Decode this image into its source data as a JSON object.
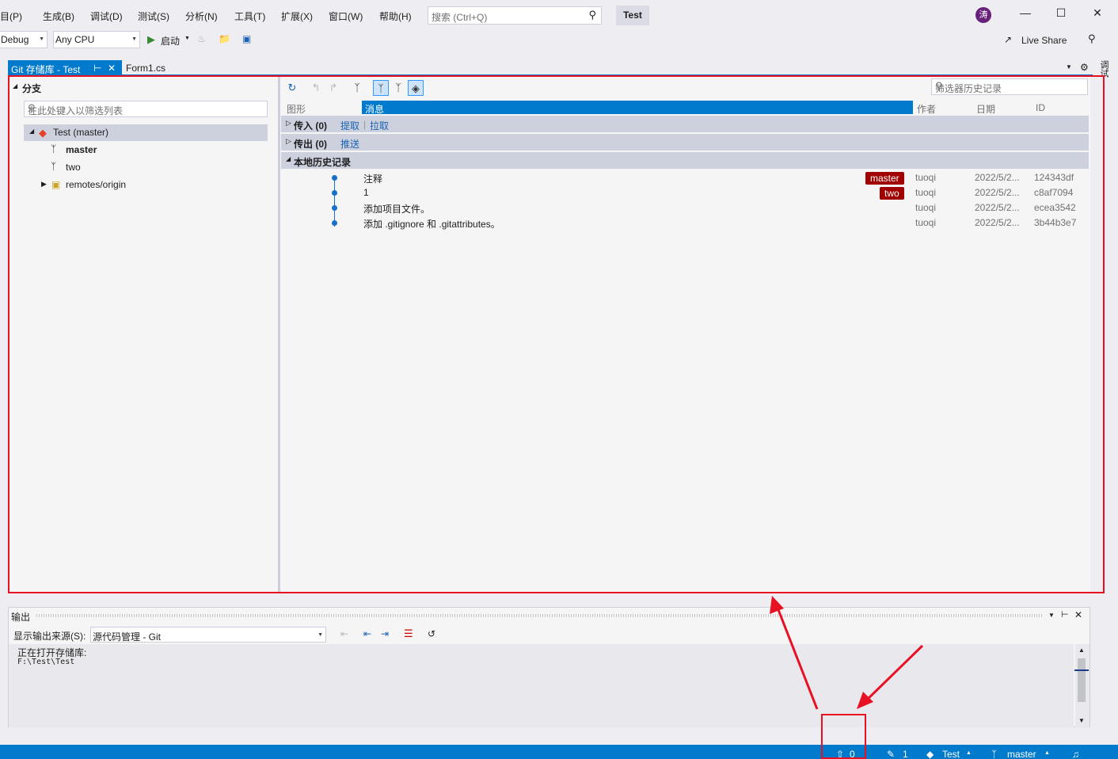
{
  "menu": {
    "items": [
      "项目(P)",
      "生成(B)",
      "调试(D)",
      "测试(S)",
      "分析(N)",
      "工具(T)",
      "扩展(X)",
      "窗口(W)",
      "帮助(H)"
    ],
    "search_placeholder": "搜索 (Ctrl+Q)",
    "solution_name": "Test",
    "avatar_letter": "涛"
  },
  "toolbar": {
    "config": "Debug",
    "platform": "Any CPU",
    "start_label": "启动",
    "live_share": "Live Share"
  },
  "tabs": {
    "git": "Git 存储库 - Test",
    "form": "Form1.cs"
  },
  "branches": {
    "header": "分支",
    "filter_placeholder": "在此处键入以筛选列表",
    "root": "Test (master)",
    "items": [
      "master",
      "two"
    ],
    "remotes": "remotes/origin"
  },
  "history": {
    "filter_placeholder": "筛选器历史记录",
    "columns": {
      "graph": "图形",
      "message": "消息",
      "author": "作者",
      "date": "日期",
      "id": "ID"
    },
    "incoming": {
      "title": "传入 (0)",
      "link1": "提取",
      "link2": "拉取"
    },
    "outgoing": {
      "title": "传出 (0)",
      "link1": "推送"
    },
    "local": {
      "title": "本地历史记录"
    },
    "commits": [
      {
        "message": "注释",
        "tag": "master",
        "author": "tuoqi",
        "date": "2022/5/2...",
        "id": "124343df"
      },
      {
        "message": "1",
        "tag": "two",
        "author": "tuoqi",
        "date": "2022/5/2...",
        "id": "c8af7094"
      },
      {
        "message": "添加项目文件。",
        "tag": "",
        "author": "tuoqi",
        "date": "2022/5/2...",
        "id": "ecea3542"
      },
      {
        "message": "添加 .gitignore 和 .gitattributes。",
        "tag": "",
        "author": "tuoqi",
        "date": "2022/5/2...",
        "id": "3b44b3e7"
      }
    ]
  },
  "output": {
    "title": "输出",
    "source_label": "显示输出来源(S):",
    "source_value": "源代码管理 - Git",
    "line1": "正在打开存储库:",
    "line2": "F:\\Test\\Test"
  },
  "status": {
    "up_count": "0",
    "edit_count": "1",
    "repo": "Test",
    "branch": "master"
  },
  "colors": {
    "accent": "#007acc",
    "annotation": "#e81123",
    "tag": "#a00000"
  }
}
